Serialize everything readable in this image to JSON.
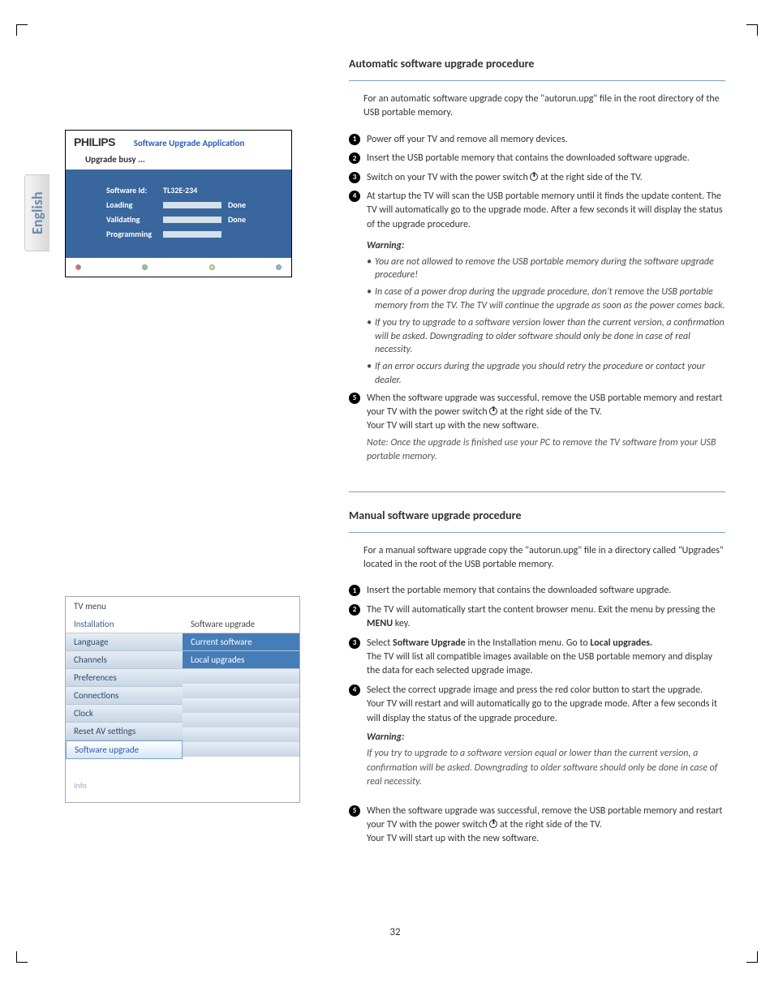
{
  "language_tab": "English",
  "page_number": "32",
  "app_screenshot": {
    "brand": "PHILIPS",
    "title": "Software Upgrade Application",
    "status": "Upgrade busy ...",
    "rows": {
      "software_id_label": "Software Id:",
      "software_id_value": "TL32E-234",
      "loading_label": "Loading",
      "loading_done": "Done",
      "validating_label": "Validating",
      "validating_done": "Done",
      "programming_label": "Programming"
    }
  },
  "auto": {
    "title": "Automatic software upgrade procedure",
    "intro": "For an automatic software upgrade copy the \"autorun.upg\" file in the root directory of the USB portable memory.",
    "steps": {
      "s1": "Power off your TV and remove all memory devices.",
      "s2": "Insert the USB portable memory that contains the downloaded software upgrade.",
      "s3a": "Switch on your TV with the power switch ",
      "s3b": " at the right side of the TV.",
      "s4": "At startup the TV will scan the USB portable memory until it finds the update content. The TV will automatically go to the upgrade mode. After a few seconds it will display the status of the upgrade procedure.",
      "s5a": "When the software upgrade was successful, remove the USB portable memory and restart your TV with the power switch ",
      "s5b": " at the right side of the TV.",
      "s5c": "Your TV will start up with the new software.",
      "s5note": "Note: Once the upgrade is finished use your PC to remove the TV software from your USB portable memory."
    },
    "warning_title": "Warning:",
    "warnings": {
      "w1": "You are not allowed to remove the USB portable memory during the software upgrade procedure!",
      "w2": "In case of a power drop during the upgrade procedure, don't remove the USB portable memory from the TV. The TV will continue the upgrade as soon as the power comes back.",
      "w3": "If you try to upgrade to a software version lower than the current version, a confirmation will be asked. Downgrading to older software should only be done in case of real necessity.",
      "w4": "If an error occurs during the upgrade you should retry the procedure or contact your dealer."
    }
  },
  "manual": {
    "title": "Manual software upgrade procedure",
    "intro": "For a manual software upgrade copy the \"autorun.upg\" file in a directory called \"Upgrades\" located in the root of the USB portable memory.",
    "steps": {
      "s1": "Insert the portable memory that contains the downloaded software upgrade.",
      "s2a": "The TV will automatically start the content browser menu. Exit the menu by pressing the ",
      "s2b": "MENU",
      "s2c": " key.",
      "s3a": "Select ",
      "s3b": "Software Upgrade",
      "s3c": " in the Installation menu. Go to ",
      "s3d": "Local upgrades.",
      "s3e": "The TV will list all compatible images available on the USB portable memory and display the data for each selected upgrade image.",
      "s4a": "Select the correct upgrade image and press the red color button to start the upgrade.",
      "s4b": "Your TV will restart and will automatically go to the upgrade mode. After a few seconds it will display the status of the upgrade procedure.",
      "s4warn_title": "Warning:",
      "s4warn": "If you try to upgrade to a software version equal or lower than the current version, a confirmation will be asked. Downgrading to older software should only be done in case of real necessity.",
      "s5a": "When the software upgrade was successful, remove the USB portable memory and restart your TV with the power switch ",
      "s5b": " at the right side of the TV.",
      "s5c": "Your TV will start up with the new software."
    }
  },
  "tvmenu": {
    "header": "TV menu",
    "left_header": "Installation",
    "right_header": "Software upgrade",
    "left_items": [
      "Language",
      "Channels",
      "Preferences",
      "Connections",
      "Clock",
      "Reset AV settings",
      "Software upgrade"
    ],
    "right_items": [
      "Current software",
      "Local upgrades"
    ],
    "footer": "Info"
  }
}
